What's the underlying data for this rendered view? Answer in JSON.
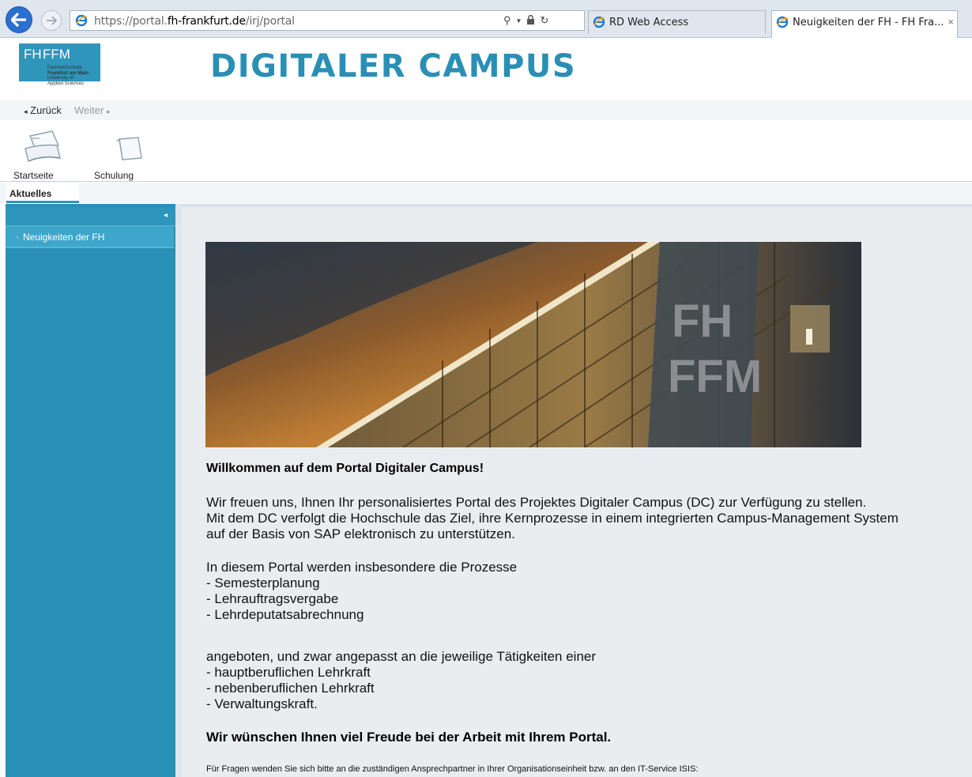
{
  "browser": {
    "url_prefix": "https://portal.",
    "url_domain": "fh-frankfurt.de",
    "url_path": "/irj/portal",
    "tabs": [
      {
        "label": "RD Web Access"
      },
      {
        "label": "Neuigkeiten der FH - FH Fra..."
      }
    ],
    "close_glyph": "×"
  },
  "header": {
    "logo": {
      "fh": "FH",
      "ffm": "FFM",
      "line1": "Fachhochschule",
      "line2": "Frankfurt am Main",
      "line3": "University of",
      "line4": "Applied Sciences"
    },
    "title": "DIGITALER CAMPUS"
  },
  "history": {
    "back": "Zurück",
    "forward": "Weiter"
  },
  "top_nav": {
    "items": [
      {
        "label": "Startseite",
        "icon": "notebook-icon"
      },
      {
        "label": "Schulung",
        "icon": "folder-icon"
      }
    ]
  },
  "sub_nav": {
    "active": "Aktuelles"
  },
  "sidebar": {
    "collapse_glyph": "◂",
    "items": [
      {
        "label": "Neuigkeiten der FH"
      }
    ]
  },
  "content": {
    "hero_text": "FH FFM",
    "welcome": "Willkommen auf dem Portal Digitaler Campus!",
    "p1_lines": [
      "Wir freuen uns, Ihnen Ihr personalisiertes Portal des Projektes Digitaler Campus (DC) zur Verfügung zu stellen.",
      "Mit dem DC verfolgt die Hochschule das Ziel, ihre Kernprozesse in einem integrierten Campus-Management System",
      "auf der Basis von SAP elektronisch zu unterstützen."
    ],
    "p2_lines": [
      "In diesem Portal werden insbesondere die Prozesse",
      "- Semesterplanung",
      "- Lehrauftragsvergabe",
      "- Lehrdeputatsabrechnung"
    ],
    "p3_lines": [
      "angeboten, und zwar angepasst an die jeweilige Tätigkeiten einer",
      "- hauptberuflichen Lehrkraft",
      "- nebenberuflichen Lehrkraft",
      "- Verwaltungskraft."
    ],
    "closing": "Wir wünschen Ihnen viel Freude bei der Arbeit mit Ihrem Portal.",
    "footer_note": "Für Fragen wenden Sie sich bitte an die zuständigen Ansprechpartner in Ihrer Organisationseinheit bzw. an den IT-Service  ISIS:"
  },
  "colors": {
    "brand": "#2f95bb",
    "sidebar": "#2a90b6",
    "title": "#2b8fb4"
  }
}
